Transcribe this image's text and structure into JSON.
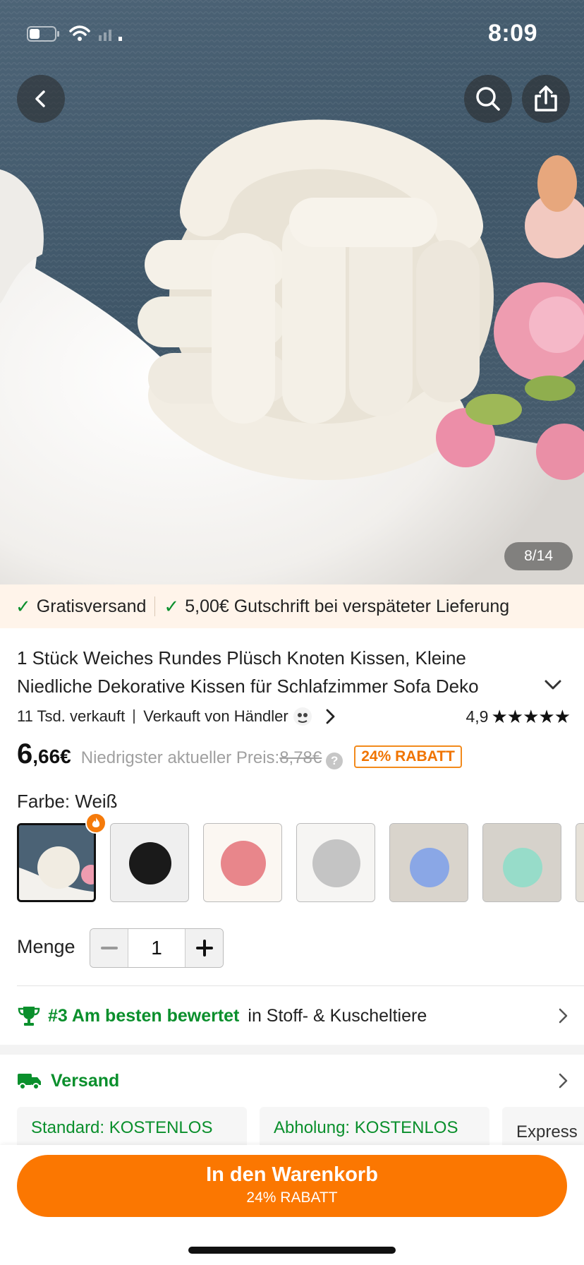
{
  "status_bar": {
    "time": "8:09"
  },
  "gallery": {
    "counter": "8/14"
  },
  "icons": {
    "back": "chevron-left-icon",
    "search": "search-icon",
    "share": "share-icon",
    "check": "checkmark-icon",
    "trophy": "trophy-icon",
    "truck": "truck-icon",
    "chevron_right": "chevron-right-icon",
    "chevron_down": "chevron-down-icon",
    "fire": "fire-icon"
  },
  "shipping_banner": {
    "free_shipping": "Gratisversand",
    "late_credit": "5,00€ Gutschrift bei verspäteter Lieferung"
  },
  "product": {
    "title": "1 Stück Weiches Rundes Plüsch Knoten Kissen, Kleine Niedliche Dekorative Kissen für Schlafzimmer Sofa Deko",
    "sold": "11 Tsd. verkauft",
    "seller": "Verkauft von Händler",
    "rating": "4,9",
    "stars": "★★★★★",
    "price_main": "6",
    "price_decimals": ",66€",
    "lowest_price_label": "Niedrigster aktueller Preis:",
    "old_price": "8,78€",
    "help": "?",
    "discount": "24% RABATT"
  },
  "color": {
    "label": "Farbe: Weiß",
    "swatches": [
      {
        "name": "Weiß",
        "color": "#f1ece2",
        "selected": true
      },
      {
        "name": "Schwarz",
        "color": "#1a1a1a",
        "selected": false
      },
      {
        "name": "Rosa",
        "color": "#e8868b",
        "selected": false
      },
      {
        "name": "Grau",
        "color": "#c4c4c4",
        "selected": false
      },
      {
        "name": "Blau",
        "color": "#8aa7e6",
        "selected": false
      },
      {
        "name": "Mint",
        "color": "#97dcc9",
        "selected": false
      }
    ]
  },
  "quantity": {
    "label": "Menge",
    "value": "1",
    "minus": "−",
    "plus": "+"
  },
  "ranking": {
    "main": "#3 Am besten bewertet",
    "sub": "in Stoff- & Kuscheltiere"
  },
  "shipping": {
    "title": "Versand",
    "options": [
      "Standard: KOSTENLOS",
      "Abholung: KOSTENLOS",
      "Express"
    ]
  },
  "cart": {
    "label": "In den Warenkorb",
    "sub": "24% RABATT"
  },
  "colors": {
    "accent": "#fb7701",
    "green": "#0a8f2c",
    "discount": "#f07400"
  }
}
